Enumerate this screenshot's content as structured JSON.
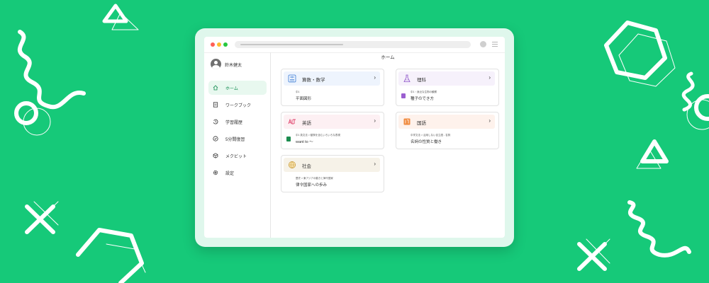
{
  "user": {
    "name": "鈴木健太"
  },
  "page": {
    "title": "ホーム"
  },
  "nav": [
    {
      "label": "ホーム",
      "icon": "home-icon",
      "active": true
    },
    {
      "label": "ワークブック",
      "icon": "workbook-icon"
    },
    {
      "label": "学習履歴",
      "icon": "history-icon"
    },
    {
      "label": "5分間復習",
      "icon": "check-circle-icon"
    },
    {
      "label": "メクビット",
      "icon": "cube-icon"
    },
    {
      "label": "設定",
      "icon": "gear-icon"
    }
  ],
  "subjects": [
    {
      "title": "算数・数学",
      "sub": "中1",
      "value": "平面図形",
      "color": "#eef4fd"
    },
    {
      "title": "理科",
      "sub": "中1・身近な生物の観察",
      "value": "種子のでき方",
      "color": "#f6f1fb"
    },
    {
      "title": "英語",
      "sub": "中1 英文法 > 動詞を含むいろいろな表現",
      "value": "want to 〜",
      "color": "#fdf0f3"
    },
    {
      "title": "国語",
      "sub": "中学文法 > 活用しない自立語 - 名詞",
      "value": "名詞の性質と働き",
      "color": "#fef2ec"
    },
    {
      "title": "社会",
      "sub": "歴史 > 東アジアの動きと律令国家",
      "value": "律令国家への歩み",
      "color": "#f6f2e8"
    }
  ],
  "colors": {
    "background": "#16c979",
    "accent": "#0e8a4e",
    "window_frame": "#dff7ec"
  }
}
